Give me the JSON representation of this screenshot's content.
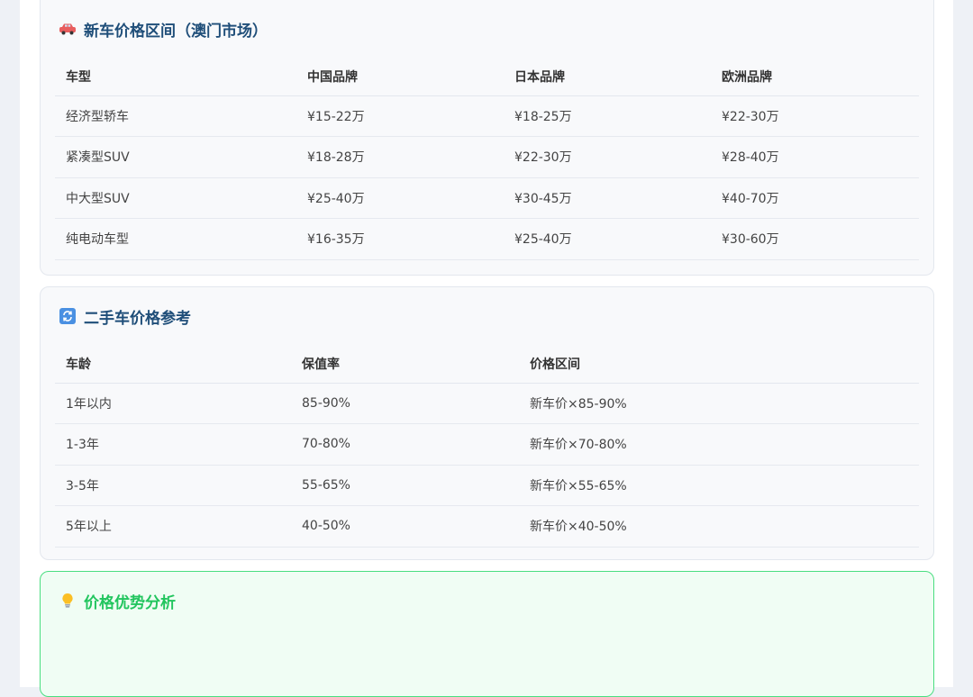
{
  "new_car": {
    "title": "新车价格区间（澳门市场）",
    "icon": "car-icon",
    "headers": [
      "车型",
      "中国品牌",
      "日本品牌",
      "欧洲品牌"
    ],
    "rows": [
      [
        "经济型轿车",
        "¥15-22万",
        "¥18-25万",
        "¥22-30万"
      ],
      [
        "紧凑型SUV",
        "¥18-28万",
        "¥22-30万",
        "¥28-40万"
      ],
      [
        "中大型SUV",
        "¥25-40万",
        "¥30-45万",
        "¥40-70万"
      ],
      [
        "纯电动车型",
        "¥16-35万",
        "¥25-40万",
        "¥30-60万"
      ]
    ]
  },
  "used_car": {
    "title": "二手车价格参考",
    "icon": "refresh-icon",
    "headers": [
      "车龄",
      "保值率",
      "价格区间"
    ],
    "rows": [
      [
        "1年以内",
        "85-90%",
        "新车价×85-90%"
      ],
      [
        "1-3年",
        "70-80%",
        "新车价×70-80%"
      ],
      [
        "3-5年",
        "55-65%",
        "新车价×55-65%"
      ],
      [
        "5年以上",
        "40-50%",
        "新车价×40-50%"
      ]
    ]
  },
  "advantage": {
    "title": "价格优势分析",
    "icon": "lightbulb-icon"
  },
  "colors": {
    "title_blue": "#1f4e79",
    "green_accent": "#22c55e",
    "green_border": "#4ade80"
  }
}
